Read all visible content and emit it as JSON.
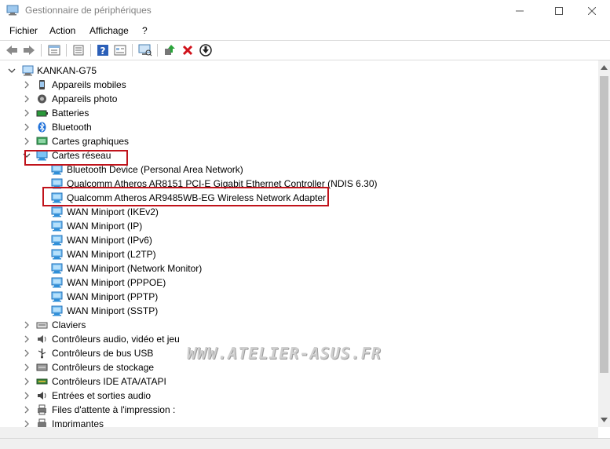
{
  "window": {
    "title": "Gestionnaire de périphériques"
  },
  "menu": {
    "items": [
      "Fichier",
      "Action",
      "Affichage",
      "?"
    ]
  },
  "toolbar": {
    "buttons": [
      "back-arrow-icon",
      "forward-arrow-icon",
      "properties-icon",
      "list-icon",
      "help-icon",
      "view-icon",
      "scan-monitor-icon",
      "update-driver-icon",
      "uninstall-x-icon",
      "disable-download-icon"
    ]
  },
  "tree": {
    "root": "KANKAN-G75",
    "categories": [
      {
        "label": "Appareils mobiles",
        "icon": "mobile-device-icon"
      },
      {
        "label": "Appareils photo",
        "icon": "camera-icon"
      },
      {
        "label": "Batteries",
        "icon": "battery-icon"
      },
      {
        "label": "Bluetooth",
        "icon": "bluetooth-icon"
      },
      {
        "label": "Cartes graphiques",
        "icon": "display-adapter-icon"
      },
      {
        "label": "Cartes réseau",
        "icon": "network-adapter-icon",
        "expanded": true
      },
      {
        "label": "Claviers",
        "icon": "keyboard-icon"
      },
      {
        "label": "Contrôleurs audio, vidéo et jeu",
        "icon": "audio-icon"
      },
      {
        "label": "Contrôleurs de bus USB",
        "icon": "usb-icon"
      },
      {
        "label": "Contrôleurs de stockage",
        "icon": "storage-icon"
      },
      {
        "label": "Contrôleurs IDE ATA/ATAPI",
        "icon": "ide-icon"
      },
      {
        "label": "Entrées et sorties audio",
        "icon": "speaker-icon"
      },
      {
        "label": "Files d'attente à l'impression :",
        "icon": "print-queue-icon"
      },
      {
        "label": "Imprimantes",
        "icon": "printer-icon"
      }
    ],
    "network_adapters": [
      "Bluetooth Device (Personal Area Network)",
      "Qualcomm Atheros AR8151 PCI-E Gigabit Ethernet Controller (NDIS 6.30)",
      "Qualcomm Atheros AR9485WB-EG Wireless Network Adapter",
      "WAN Miniport (IKEv2)",
      "WAN Miniport (IP)",
      "WAN Miniport (IPv6)",
      "WAN Miniport (L2TP)",
      "WAN Miniport (Network Monitor)",
      "WAN Miniport (PPPOE)",
      "WAN Miniport (PPTP)",
      "WAN Miniport (SSTP)"
    ]
  },
  "watermark": {
    "text": "WWW.ATELIER-ASUS.FR"
  },
  "colors": {
    "highlight_box": "#c0131b",
    "network_icon": "#2f8fd8"
  }
}
